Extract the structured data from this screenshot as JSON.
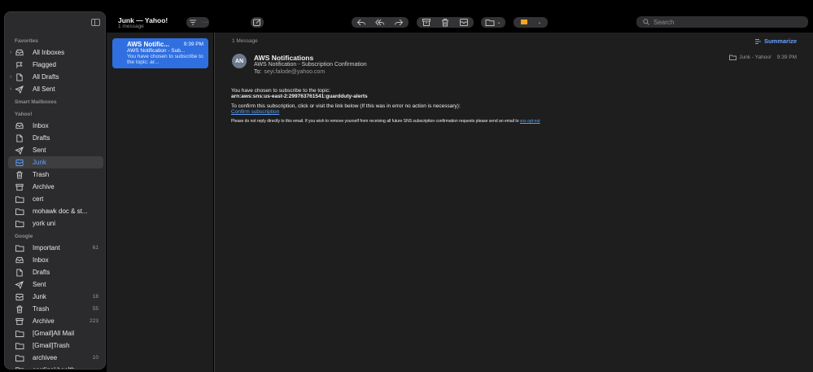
{
  "sidebar": {
    "sections": {
      "favorites": "Favorites",
      "smart": "Smart Mailboxes",
      "yahoo": "Yahoo!",
      "google": "Google"
    },
    "favorites": [
      {
        "label": "All Inboxes",
        "icon": "tray-icon"
      },
      {
        "label": "Flagged",
        "icon": "flag-icon"
      },
      {
        "label": "All Drafts",
        "icon": "document-icon"
      },
      {
        "label": "All Sent",
        "icon": "paperplane-icon"
      }
    ],
    "yahoo": [
      {
        "label": "Inbox",
        "icon": "tray-icon",
        "count": ""
      },
      {
        "label": "Drafts",
        "icon": "document-icon",
        "count": ""
      },
      {
        "label": "Sent",
        "icon": "paperplane-icon",
        "count": ""
      },
      {
        "label": "Junk",
        "icon": "junk-icon",
        "count": ""
      },
      {
        "label": "Trash",
        "icon": "trash-icon",
        "count": ""
      },
      {
        "label": "Archive",
        "icon": "archive-icon",
        "count": ""
      },
      {
        "label": "cert",
        "icon": "folder-icon",
        "count": ""
      },
      {
        "label": "mohawk doc & st...",
        "icon": "folder-icon",
        "count": ""
      },
      {
        "label": "york uni",
        "icon": "folder-icon",
        "count": ""
      }
    ],
    "google": [
      {
        "label": "Important",
        "icon": "folder-icon",
        "count": "61"
      },
      {
        "label": "Inbox",
        "icon": "tray-icon",
        "count": ""
      },
      {
        "label": "Drafts",
        "icon": "document-icon",
        "count": ""
      },
      {
        "label": "Sent",
        "icon": "paperplane-icon",
        "count": ""
      },
      {
        "label": "Junk",
        "icon": "junk-icon",
        "count": "18"
      },
      {
        "label": "Trash",
        "icon": "trash-icon",
        "count": "55"
      },
      {
        "label": "Archive",
        "icon": "archive-icon",
        "count": "223"
      },
      {
        "label": "[Gmail]All Mail",
        "icon": "folder-icon",
        "count": ""
      },
      {
        "label": "[Gmail]Trash",
        "icon": "folder-icon",
        "count": ""
      },
      {
        "label": "archivee",
        "icon": "folder-icon",
        "count": "10"
      },
      {
        "label": "cardinal health",
        "icon": "folder-icon",
        "count": ""
      }
    ]
  },
  "message_list": {
    "title": "Junk — Yahoo!",
    "subtitle": "1 message",
    "items": [
      {
        "from": "AWS Notific...",
        "time": "9:39 PM",
        "subject": "AWS Notification - Sub...",
        "preview": "You have chosen to subscribe to the topic: ar..."
      }
    ]
  },
  "toolbar": {
    "search_placeholder": "Search",
    "icons": [
      "filter-icon",
      "more-icon",
      "compose-icon",
      "reply-icon",
      "reply-all-icon",
      "forward-icon",
      "archive-icon",
      "trash-icon",
      "junk-icon",
      "move-icon",
      "flag-icon"
    ]
  },
  "reader": {
    "message_count": "1 Message",
    "summarize_label": "Summarize",
    "avatar_initials": "AN",
    "from": "AWS Notifications",
    "subject": "AWS Notification - Subscription Confirmation",
    "to_label": "To:",
    "to_address": "seyi.falode@yahoo.com",
    "mailbox": "Junk - Yahoo!",
    "time": "9:39 PM",
    "body": {
      "line1": "You have chosen to subscribe to the topic:",
      "topic": "arn:aws:sns:us-east-2:299763761541:guardduty-alerts",
      "line2": "To confirm this subscription, click or visit the link below (If this was in error no action is necessary):",
      "confirm_link": "Confirm subscription",
      "footer": "Please do not reply directly to this email. If you wish to remove yourself from receiving all future SNS subscription confirmation requests please send an email to",
      "optout_link": "sns opt-out"
    }
  },
  "colors": {
    "accent": "#2f6fe0",
    "link": "#5aa3ff",
    "flag": "#f5a623"
  }
}
